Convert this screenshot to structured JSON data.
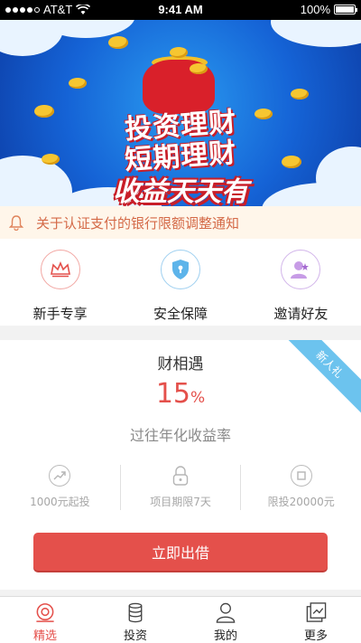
{
  "status_bar": {
    "carrier": "AT&T",
    "time": "9:41 AM",
    "battery": "100%"
  },
  "banner": {
    "line1": "投资理财",
    "line2": "短期理财",
    "line3": "收益天天有",
    "page_count": 3,
    "active_page": 1
  },
  "notice": {
    "text": "关于认证支付的银行限额调整通知"
  },
  "features": [
    {
      "label": "新手专享",
      "icon": "crown-icon",
      "color": "#e4504b"
    },
    {
      "label": "安全保障",
      "icon": "shield-icon",
      "color": "#3aa0e0"
    },
    {
      "label": "邀请好友",
      "icon": "friends-icon",
      "color": "#a46ad0"
    }
  ],
  "product": {
    "ribbon": "新人礼",
    "name": "财相遇",
    "rate_value": "15",
    "rate_unit": "%",
    "rate_label": "过往年化收益率",
    "stats": [
      {
        "label": "1000元起投",
        "icon": "trend-icon"
      },
      {
        "label": "项目期限7天",
        "icon": "lock-icon"
      },
      {
        "label": "限投20000元",
        "icon": "limit-icon"
      }
    ],
    "cta_label": "立即出借",
    "accent_color": "#e4504b"
  },
  "tabbar": [
    {
      "label": "精选",
      "icon": "featured-icon",
      "active": true
    },
    {
      "label": "投资",
      "icon": "coins-icon",
      "active": false
    },
    {
      "label": "我的",
      "icon": "user-icon",
      "active": false
    },
    {
      "label": "更多",
      "icon": "more-icon",
      "active": false
    }
  ]
}
